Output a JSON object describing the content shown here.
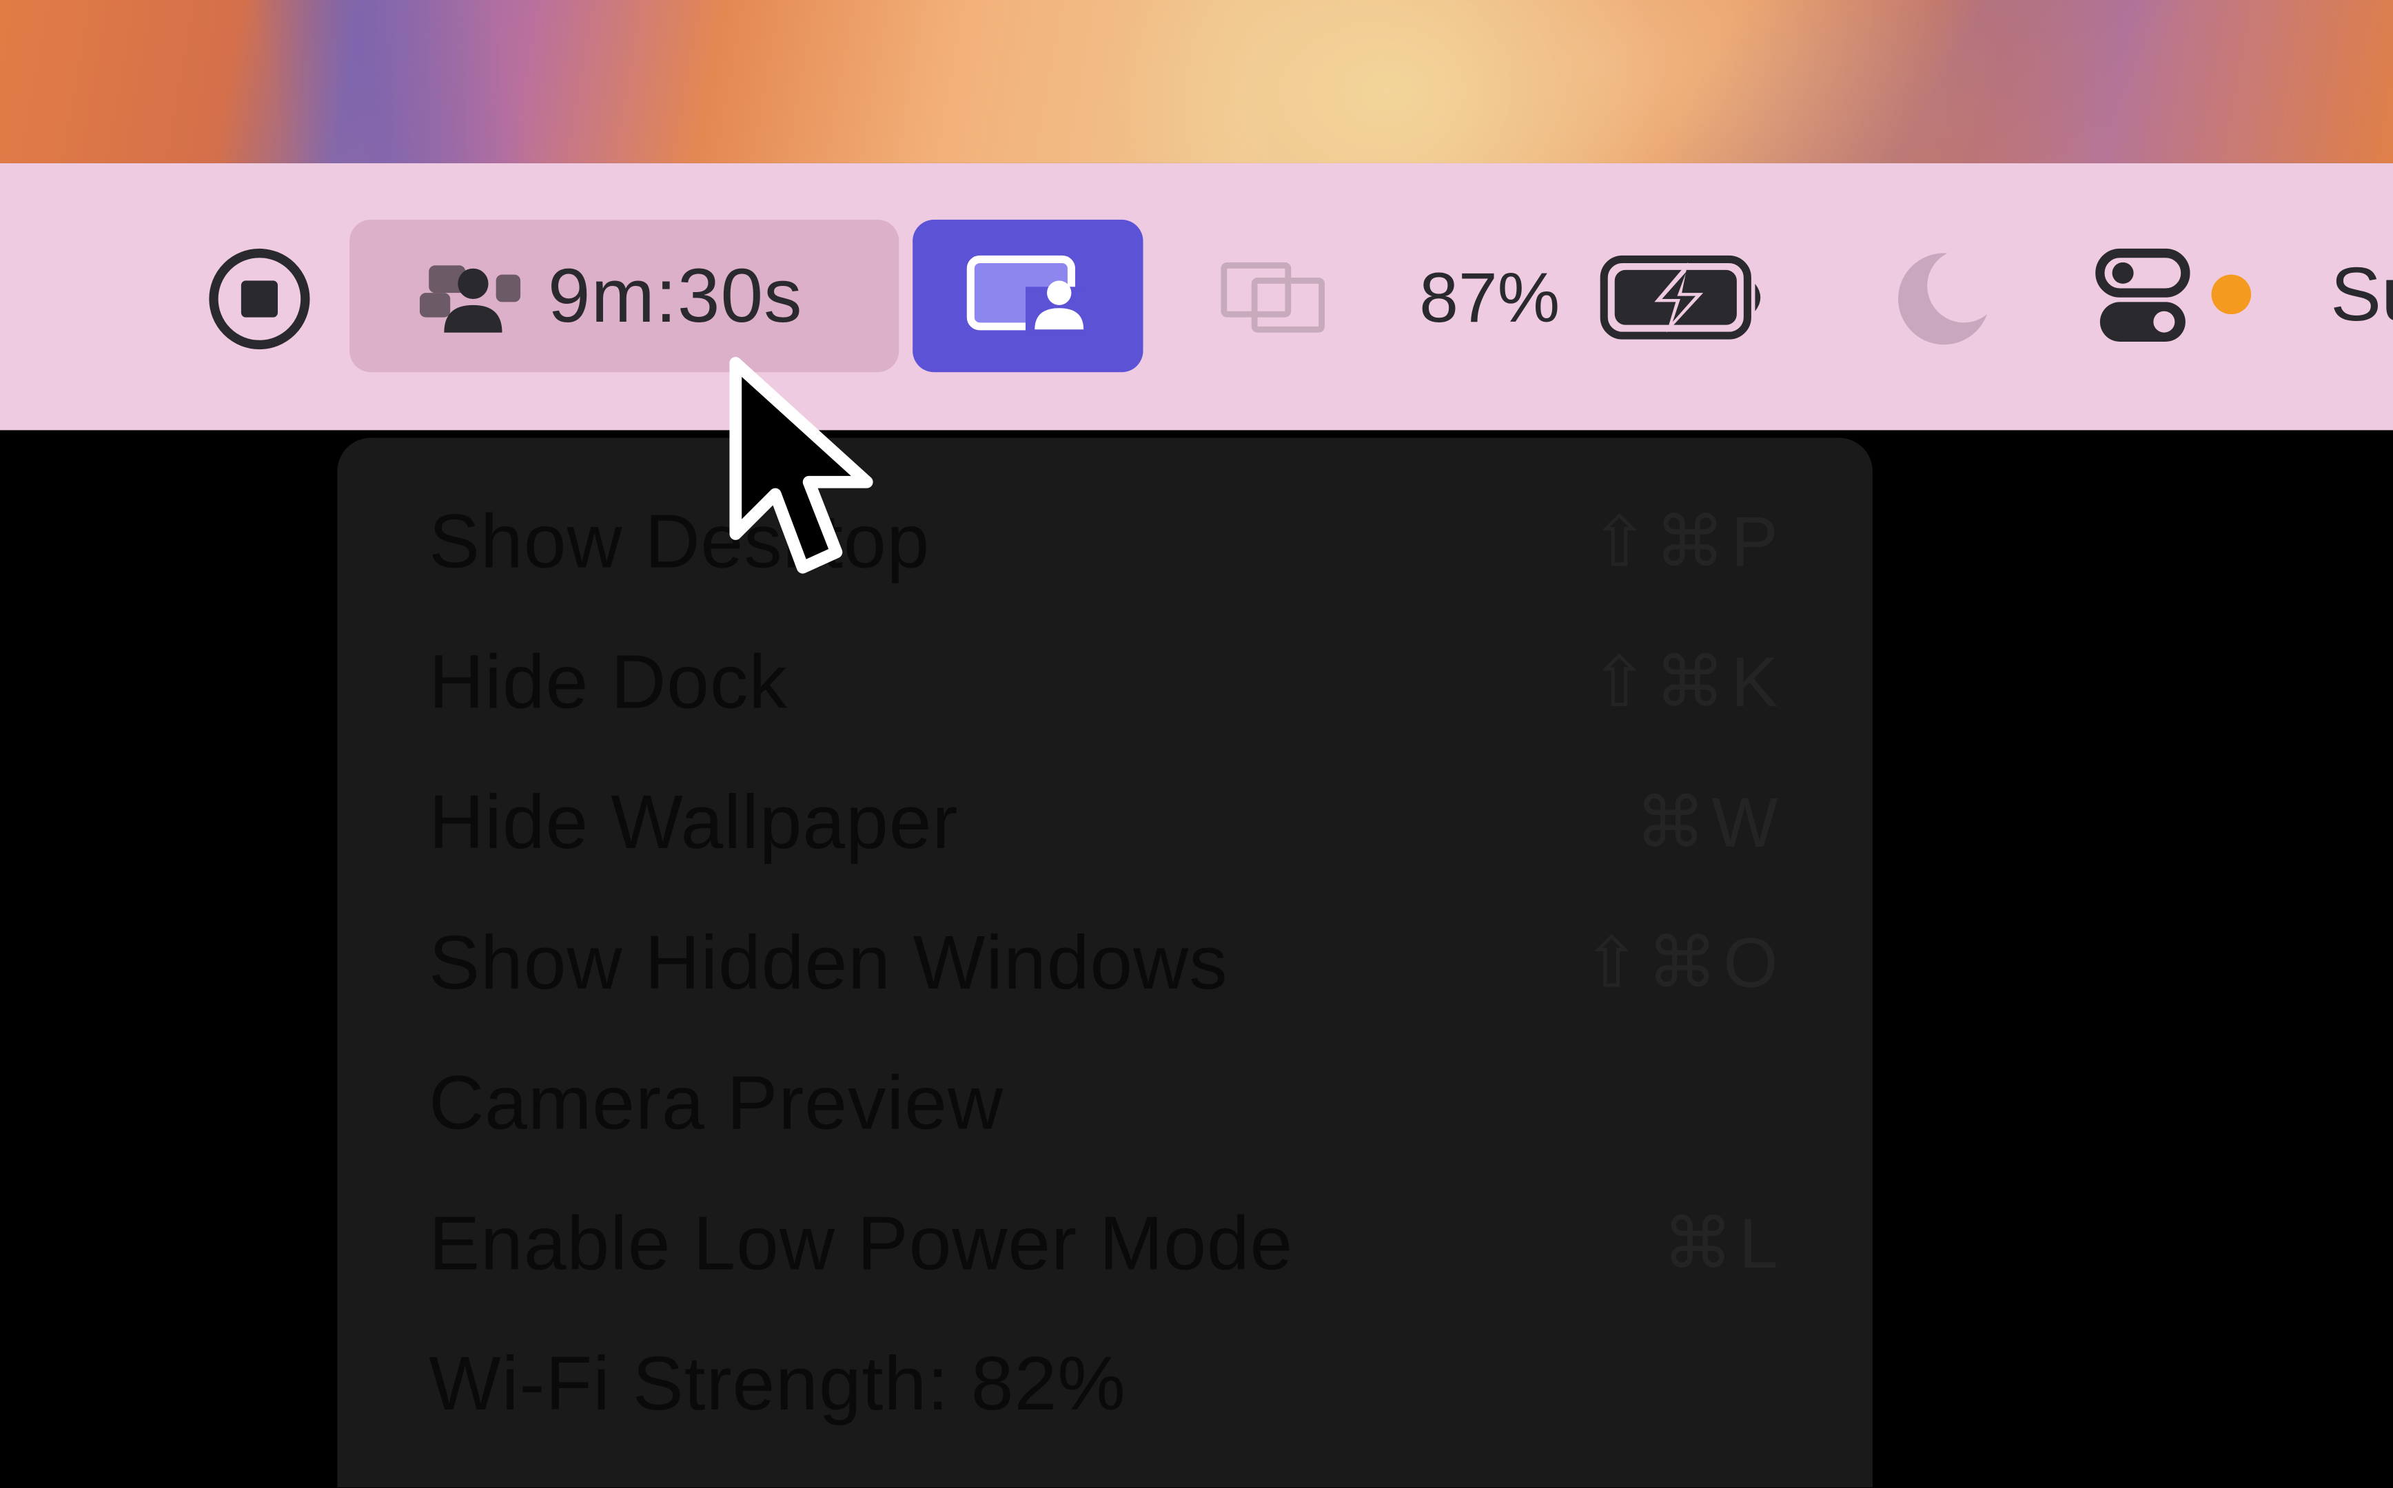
{
  "menubar": {
    "timer": "9m:30s",
    "battery_percent": "87%",
    "clock_partial": "Su",
    "icons": {
      "stop": "stop-record-icon",
      "participants": "participants-icon",
      "camera": "camera-overlay-icon",
      "windows": "windows-overlap-icon",
      "battery": "battery-charging-icon",
      "moon": "focus-moon-icon",
      "control_center": "control-center-icon"
    },
    "colors": {
      "bar": "#efcbe1",
      "active_button": "#5b52d6",
      "status_dot": "#f39a1f"
    }
  },
  "dropdown": {
    "items": [
      {
        "label": "Show Desktop",
        "shortcut": "⇧⌘P"
      },
      {
        "label": "Hide Dock",
        "shortcut": "⇧⌘K"
      },
      {
        "label": "Hide Wallpaper",
        "shortcut": "⌘W"
      },
      {
        "label": "Show Hidden Windows",
        "shortcut": "⇧⌘O"
      },
      {
        "label": "Camera Preview",
        "shortcut": ""
      },
      {
        "label": "Enable Low Power Mode",
        "shortcut": "⌘L"
      },
      {
        "label": "Wi-Fi Strength: 82%",
        "shortcut": ""
      }
    ]
  }
}
